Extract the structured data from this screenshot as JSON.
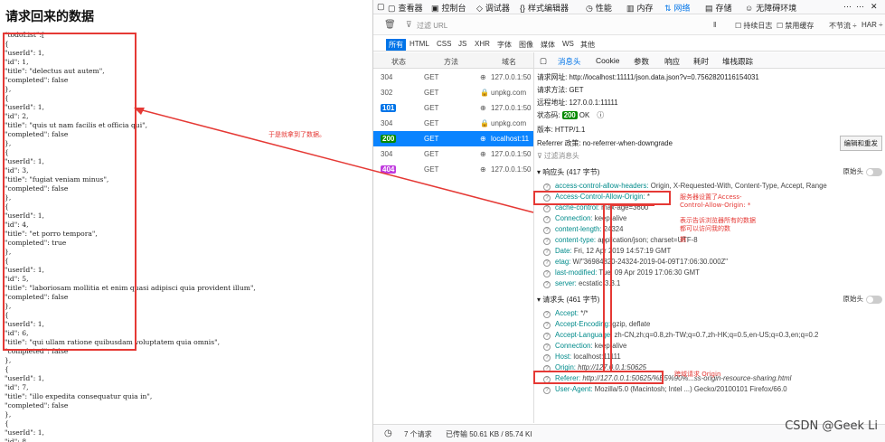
{
  "left": {
    "title": "请求回来的数据",
    "json_text": "\"todoList\":[\n{\n\"userId\": 1,\n\"id\": 1,\n\"title\": \"delectus aut autem\",\n\"completed\": false\n},\n{\n\"userId\": 1,\n\"id\": 2,\n\"title\": \"quis ut nam facilis et officia qui\",\n\"completed\": false\n},\n{\n\"userId\": 1,\n\"id\": 3,\n\"title\": \"fugiat veniam minus\",\n\"completed\": false\n},\n{\n\"userId\": 1,\n\"id\": 4,\n\"title\": \"et porro tempora\",\n\"completed\": true\n},\n{\n\"userId\": 1,\n\"id\": 5,\n\"title\": \"laboriosam mollitia et enim quasi adipisci quia provident illum\",\n\"completed\": false\n},\n{\n\"userId\": 1,\n\"id\": 6,\n\"title\": \"qui ullam ratione quibusdam voluptatem quia omnis\",\n\"completed\": false\n},\n{\n\"userId\": 1,\n\"id\": 7,\n\"title\": \"illo expedita consequatur quia in\",\n\"completed\": false\n},\n{\n\"userId\": 1,\n\"id\": 8,"
  },
  "devtools": {
    "main_tabs": [
      "查看器",
      "控制台",
      "调试器",
      "样式编辑器",
      "性能",
      "内存",
      "网络",
      "存储",
      "无障碍环境"
    ],
    "filter_placeholder": "过滤 URL",
    "persist_log": "持续日志",
    "disable_cache": "禁用缓存",
    "throttle": "不节流",
    "har": "HAR",
    "filter_tabs": [
      "所有",
      "HTML",
      "CSS",
      "JS",
      "XHR",
      "字体",
      "图像",
      "媒体",
      "WS",
      "其他"
    ],
    "col_status": "状态",
    "col_method": "方法",
    "col_domain": "域名",
    "requests": [
      {
        "status": "304",
        "method": "GET",
        "domain": "127.0.0.1:50"
      },
      {
        "status": "302",
        "method": "GET",
        "domain": "unpkg.com"
      },
      {
        "status": "101",
        "method": "GET",
        "domain": "127.0.0.1:50"
      },
      {
        "status": "304",
        "method": "GET",
        "domain": "unpkg.com"
      },
      {
        "status": "200",
        "method": "GET",
        "domain": "localhost:11"
      },
      {
        "status": "304",
        "method": "GET",
        "domain": "127.0.0.1:50"
      },
      {
        "status": "404",
        "method": "GET",
        "domain": "127.0.0.1:50"
      }
    ],
    "detail_tabs": [
      "消息头",
      "Cookie",
      "参数",
      "响应",
      "耗时",
      "堆栈跟踪"
    ],
    "request_url": "请求网址: http://localhost:11111/json.data.json?v=0.7562820116154031",
    "request_method": "请求方法: GET",
    "remote_addr": "远程地址: 127.0.0.1:11111",
    "status_code_label": "状态码:",
    "status_code": "200",
    "status_text": "OK",
    "version": "版本: HTTP/1.1",
    "referrer_policy": "Referrer 政策: no-referrer-when-downgrade",
    "edit_resend": "编辑和重发",
    "filter_headers": "过滤消息头",
    "response_headers_title": "响应头 (417 字节)",
    "raw_header": "原始头",
    "response_headers": [
      {
        "k": "access-control-allow-headers:",
        "v": "Origin, X-Requested-With, Content-Type, Accept, Range"
      },
      {
        "k": "Access-Control-Allow-Origin:",
        "v": "*"
      },
      {
        "k": "cache-control:",
        "v": "max-age=3600"
      },
      {
        "k": "Connection:",
        "v": "keep-alive"
      },
      {
        "k": "content-length:",
        "v": "24324"
      },
      {
        "k": "content-type:",
        "v": "application/json; charset=UTF-8"
      },
      {
        "k": "Date:",
        "v": "Fri, 12 Apr 2019 14:57:19 GMT"
      },
      {
        "k": "etag:",
        "v": "W/\"36984820-24324-2019-04-09T17:06:30.000Z\""
      },
      {
        "k": "last-modified:",
        "v": "Tue, 09 Apr 2019 17:06:30 GMT"
      },
      {
        "k": "server:",
        "v": "ecstatic-3.3.1"
      }
    ],
    "request_headers_title": "请求头 (461 字节)",
    "request_headers": [
      {
        "k": "Accept:",
        "v": "*/*"
      },
      {
        "k": "Accept-Encoding:",
        "v": "gzip, deflate"
      },
      {
        "k": "Accept-Language:",
        "v": "zh-CN,zh;q=0.8,zh-TW;q=0.7,zh-HK;q=0.5,en-US;q=0.3,en;q=0.2"
      },
      {
        "k": "Connection:",
        "v": "keep-alive"
      },
      {
        "k": "Host:",
        "v": "localhost:11111"
      },
      {
        "k": "Origin:",
        "v": "http://127.0.0.1:50625"
      },
      {
        "k": "Referer:",
        "v": "http://127.0.0.1:50625/%E5%90%...ss-origin-resource-sharing.html"
      },
      {
        "k": "User-Agent:",
        "v": "Mozilla/5.0 (Macintosh; Intel ...) Gecko/20100101 Firefox/66.0"
      }
    ],
    "bottom_requests": "7 个请求",
    "bottom_transferred": "已传输 50.61 KB / 85.74 KI"
  },
  "annotations": {
    "got_data": "于是就拿到了数据。",
    "server_set": "服务器设置了Access-Control-Allow-Origin: *",
    "server_desc": "表示告诉浏览器所有的数据都可以访问我的数",
    "server_desc2": "据",
    "cross_origin": "跨域请求 Origin"
  },
  "watermark": "CSDN @Geek Li"
}
